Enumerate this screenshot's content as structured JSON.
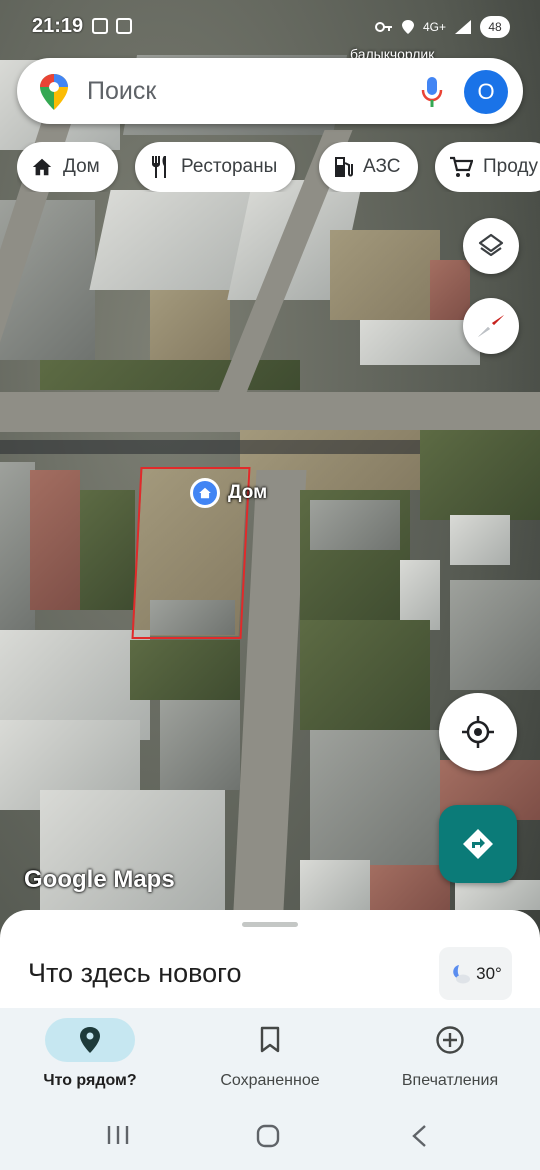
{
  "status_bar": {
    "time": "21:19",
    "network": "4G+",
    "battery": "48"
  },
  "map": {
    "place_label": "балыкчорлик",
    "home_marker_label": "Дом",
    "logo_text": "Google Maps"
  },
  "search": {
    "placeholder": "Поиск",
    "avatar_letter": "О"
  },
  "chips": [
    {
      "label": "Дом",
      "icon": "home-icon"
    },
    {
      "label": "Рестораны",
      "icon": "restaurant-icon"
    },
    {
      "label": "АЗС",
      "icon": "gas-station-icon"
    },
    {
      "label": "Проду",
      "icon": "grocery-cart-icon"
    }
  ],
  "sheet": {
    "title": "Что здесь нового",
    "weather_temp": "30°"
  },
  "bottom_nav": [
    {
      "label": "Что рядом?",
      "icon": "location-pin-icon",
      "active": true
    },
    {
      "label": "Сохраненное",
      "icon": "bookmark-icon",
      "active": false
    },
    {
      "label": "Впечатления",
      "icon": "add-circle-icon",
      "active": false
    }
  ],
  "colors": {
    "accent_blue": "#1a73e8",
    "directions_teal": "#0b7b78",
    "active_nav": "#c6e7f1",
    "plot_outline": "#e12a2a"
  }
}
